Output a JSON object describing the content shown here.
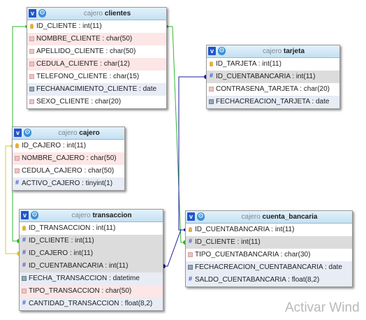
{
  "tables": {
    "clientes": {
      "db": "cajero",
      "name": "clientes",
      "fields": [
        {
          "label": "ID_CLIENTE : int(11)",
          "icon": "key"
        },
        {
          "label": "NOMBRE_CLIENTE : char(50)",
          "icon": "text"
        },
        {
          "label": "APELLIDO_CLIENTE : char(50)",
          "icon": "text"
        },
        {
          "label": "CEDULA_CLIENTE : char(12)",
          "icon": "text"
        },
        {
          "label": "TELEFONO_CLIENTE : char(15)",
          "icon": "text"
        },
        {
          "label": "FECHANACIMIENTO_CLIENTE : date",
          "icon": "date"
        },
        {
          "label": "SEXO_CLIENTE : char(20)",
          "icon": "text"
        }
      ]
    },
    "cajero": {
      "db": "cajero",
      "name": "cajero",
      "fields": [
        {
          "label": "ID_CAJERO : int(11)",
          "icon": "key"
        },
        {
          "label": "NOMBRE_CAJERO : char(50)",
          "icon": "text"
        },
        {
          "label": "CEDULA_CAJERO : char(50)",
          "icon": "text"
        },
        {
          "label": "ACTIVO_CAJERO : tinyint(1)",
          "icon": "num"
        }
      ]
    },
    "transaccion": {
      "db": "cajero",
      "name": "transaccion",
      "fields": [
        {
          "label": "ID_TRANSACCION : int(11)",
          "icon": "key"
        },
        {
          "label": "ID_CLIENTE : int(11)",
          "icon": "fk"
        },
        {
          "label": "ID_CAJERO : int(11)",
          "icon": "fk"
        },
        {
          "label": "ID_CUENTABANCARIA : int(11)",
          "icon": "fk"
        },
        {
          "label": "FECHA_TRANSACCION : datetime",
          "icon": "date"
        },
        {
          "label": "TIPO_TRANSACCION : char(50)",
          "icon": "text"
        },
        {
          "label": "CANTIDAD_TRANSACCION : float(8,2)",
          "icon": "num"
        }
      ]
    },
    "tarjeta": {
      "db": "cajero",
      "name": "tarjeta",
      "fields": [
        {
          "label": "ID_TARJETA : int(11)",
          "icon": "key"
        },
        {
          "label": "ID_CUENTABANCARIA : int(11)",
          "icon": "fk"
        },
        {
          "label": "CONTRASENA_TARJETA : char(20)",
          "icon": "text"
        },
        {
          "label": "FECHACREACION_TARJETA : date",
          "icon": "date"
        }
      ]
    },
    "cuenta_bancaria": {
      "db": "cajero",
      "name": "cuenta_bancaria",
      "fields": [
        {
          "label": "ID_CUENTABANCARIA : int(11)",
          "icon": "key"
        },
        {
          "label": "ID_CLIENTE : int(11)",
          "icon": "fk"
        },
        {
          "label": "TIPO_CUENTABANCARIA : char(30)",
          "icon": "text"
        },
        {
          "label": "FECHACREACION_CUENTABANCARIA : date",
          "icon": "date"
        },
        {
          "label": "SALDO_CUENTABANCARIA : float(8,2)",
          "icon": "num"
        }
      ]
    }
  },
  "relations": [
    {
      "from": "transaccion.ID_CLIENTE",
      "to": "clientes.ID_CLIENTE",
      "color": "#2fb82f"
    },
    {
      "from": "cuenta_bancaria.ID_CLIENTE",
      "to": "clientes.ID_CLIENTE",
      "color": "#2fb82f"
    },
    {
      "from": "transaccion.ID_CAJERO",
      "to": "cajero.ID_CAJERO",
      "color": "#d6cf2a"
    },
    {
      "from": "transaccion.ID_CUENTABANCARIA",
      "to": "cuenta_bancaria.ID_CUENTABANCARIA",
      "color": "#1d1d9e"
    },
    {
      "from": "tarjeta.ID_CUENTABANCARIA",
      "to": "cuenta_bancaria.ID_CUENTABANCARIA",
      "color": "#1d1d9e"
    }
  ],
  "header_icons": {
    "toggle": "v",
    "options": "gear-icon"
  },
  "watermark": "Activar Wind"
}
